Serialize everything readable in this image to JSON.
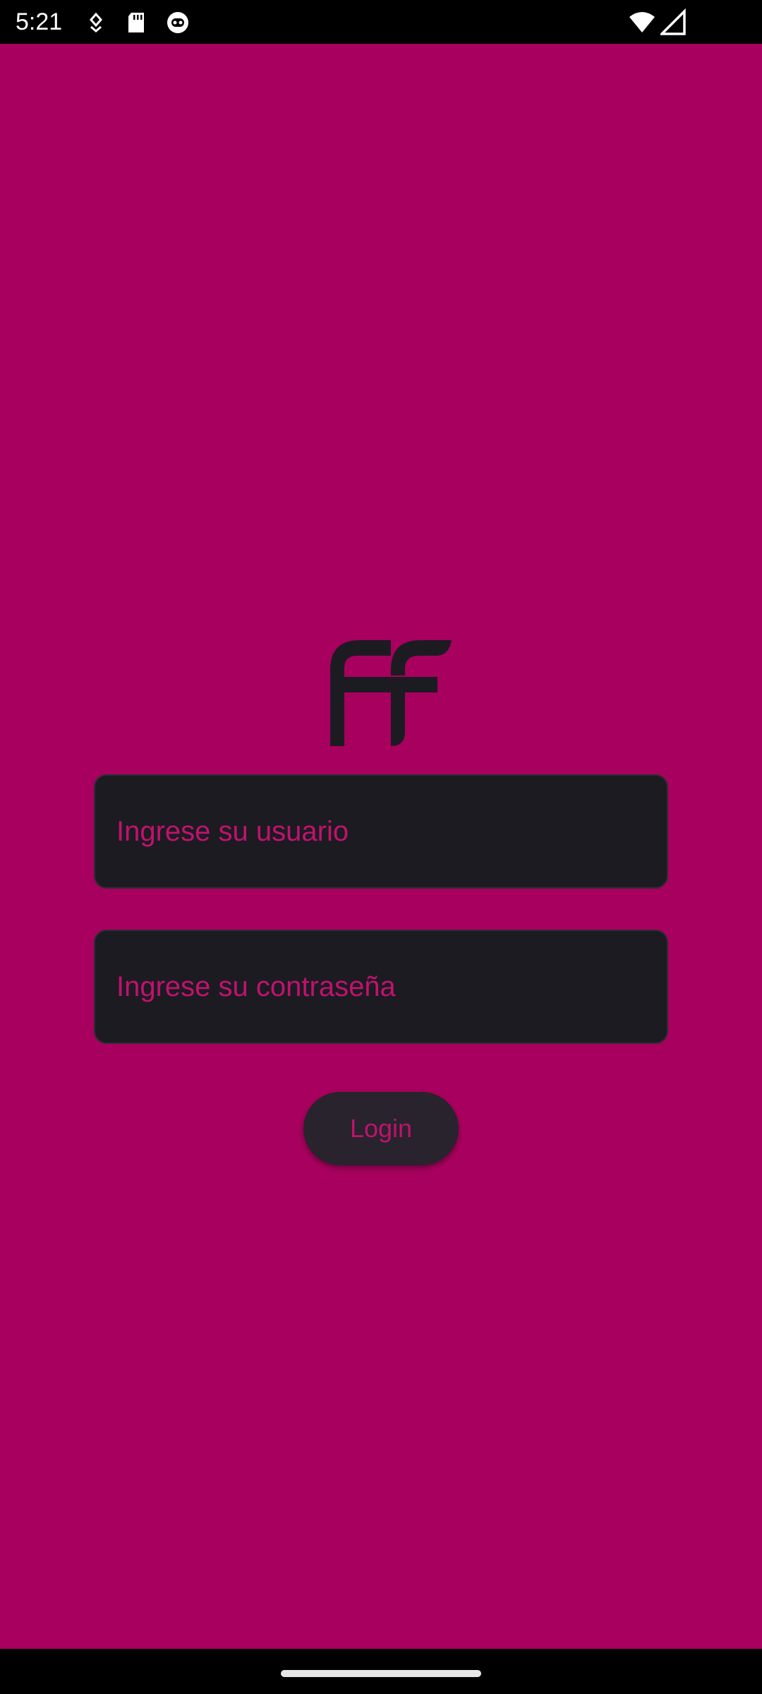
{
  "status_bar": {
    "time": "5:21",
    "icons": [
      "data-saver-icon",
      "sd-card-icon",
      "app-notification-icon",
      "wifi-icon",
      "cell-signal-icon"
    ]
  },
  "login": {
    "logo_icon": "ff-logo-icon",
    "username_placeholder": "Ingrese su usuario",
    "password_placeholder": "Ingrese su contraseña",
    "login_label": "Login"
  },
  "colors": {
    "background": "#a8005e",
    "field_background": "#1c1b22",
    "accent_text": "#c0126e",
    "button_background": "#28232d"
  }
}
